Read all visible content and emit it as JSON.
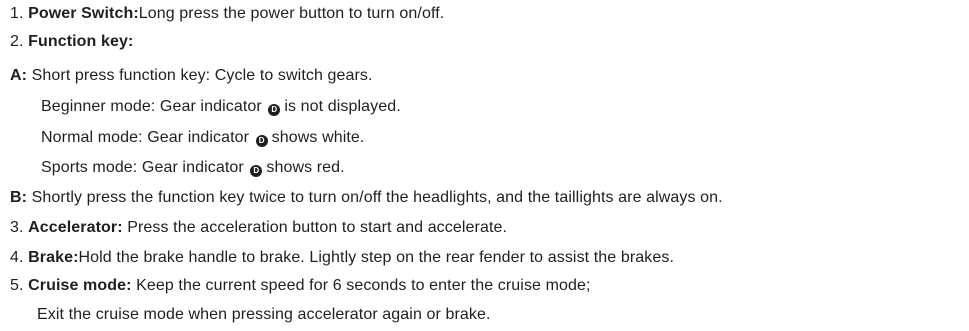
{
  "items": [
    {
      "num": "1.",
      "label": "Power Switch:",
      "text": "Long press the power button to turn on/off."
    },
    {
      "num": "2.",
      "label": "Function key:",
      "text": ""
    },
    {
      "num": "",
      "label": "A:",
      "text": " Short press function key: Cycle to switch gears."
    },
    {
      "pre": "Beginner mode: Gear indicator",
      "post": "is not displayed."
    },
    {
      "pre": "Normal mode: Gear indicator",
      "post": "shows white."
    },
    {
      "pre": "Sports mode: Gear indicator",
      "post": "shows red."
    },
    {
      "num": "",
      "label": "B:",
      "text": " Shortly press the function key twice to turn on/off the headlights, and the taillights are always on."
    },
    {
      "num": "3.",
      "label": "Accelerator:",
      "text": " Press the acceleration button to start and accelerate."
    },
    {
      "num": "4.",
      "label": "Brake:",
      "text": "Hold the brake handle to brake. Lightly step on the rear fender to assist the brakes."
    },
    {
      "num": "5.",
      "label": "Cruise mode:",
      "text": " Keep the current speed for 6 seconds to enter the cruise mode;"
    },
    {
      "text": "Exit the cruise mode when pressing accelerator again or brake."
    }
  ],
  "gear_icon_letter": "D"
}
